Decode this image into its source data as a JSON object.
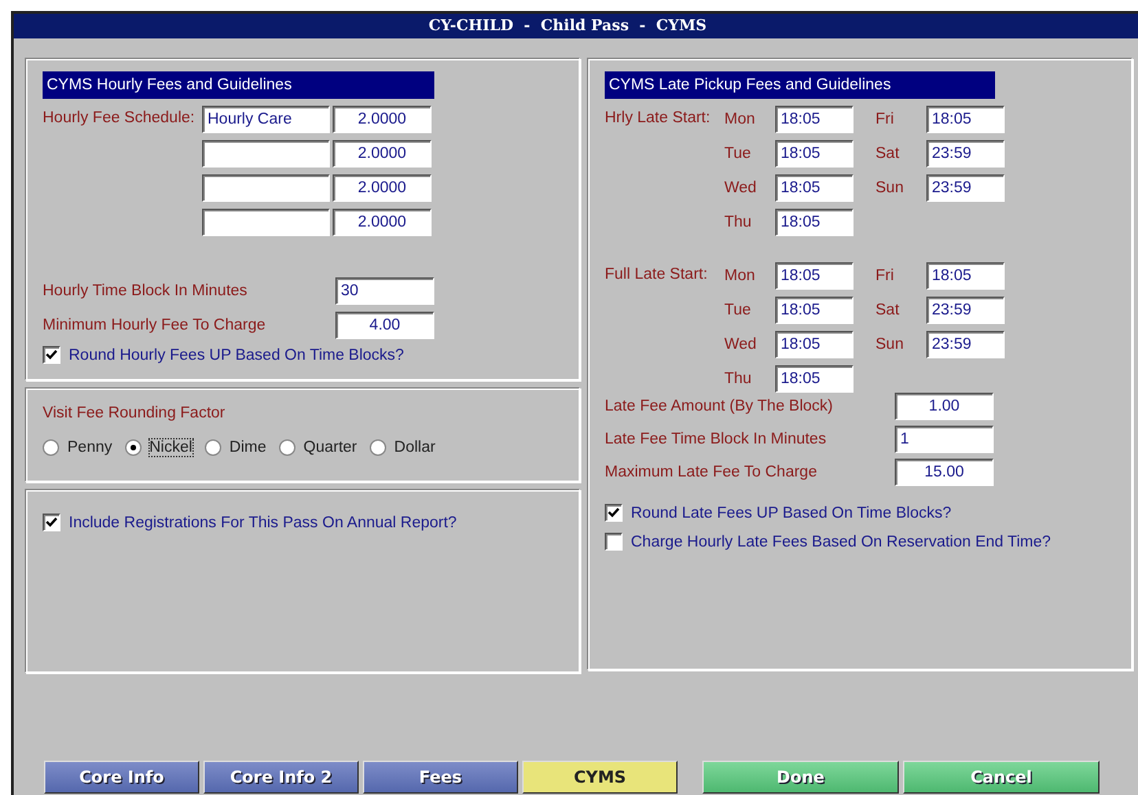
{
  "window": {
    "title": "CY-CHILD  -  Child Pass  -  CYMS"
  },
  "hourly": {
    "header": "CYMS Hourly Fees and Guidelines",
    "schedule_label": "Hourly Fee Schedule:",
    "schedule": [
      {
        "name": "Hourly Care",
        "amount": "2.0000"
      },
      {
        "amount": "2.0000"
      },
      {
        "amount": "2.0000"
      },
      {
        "amount": "2.0000"
      }
    ],
    "fields": [
      {
        "label": "Hourly Time Block In Minutes",
        "value": "30",
        "kind": "minutes"
      },
      {
        "label": "Minimum Hourly Fee To Charge",
        "value": "4.00",
        "kind": "amount"
      }
    ],
    "round": {
      "label": "Round Hourly Fees UP Based On Time Blocks?",
      "checked": true
    }
  },
  "rounding": {
    "label": "Visit Fee Rounding Factor",
    "options": [
      {
        "label": "Penny",
        "selected": false
      },
      {
        "label": "Nickel",
        "selected": true
      },
      {
        "label": "Dime",
        "selected": false
      },
      {
        "label": "Quarter",
        "selected": false
      },
      {
        "label": "Dollar",
        "selected": false
      }
    ]
  },
  "annual": {
    "label": "Include Registrations For This Pass On Annual Report?",
    "checked": true
  },
  "late": {
    "header": "CYMS Late Pickup Fees and Guidelines",
    "groups": [
      {
        "label": "Hrly Late Start:",
        "days": [
          {
            "day": "Mon",
            "time": "18:05"
          },
          {
            "day": "Tue",
            "time": "18:05"
          },
          {
            "day": "Wed",
            "time": "18:05"
          },
          {
            "day": "Thu",
            "time": "18:05"
          },
          {
            "day": "Fri",
            "time": "18:05"
          },
          {
            "day": "Sat",
            "time": "23:59"
          },
          {
            "day": "Sun",
            "time": "23:59"
          }
        ]
      },
      {
        "label": "Full Late Start:",
        "days": [
          {
            "day": "Mon",
            "time": "18:05"
          },
          {
            "day": "Tue",
            "time": "18:05"
          },
          {
            "day": "Wed",
            "time": "18:05"
          },
          {
            "day": "Thu",
            "time": "18:05"
          },
          {
            "day": "Fri",
            "time": "18:05"
          },
          {
            "day": "Sat",
            "time": "23:59"
          },
          {
            "day": "Sun",
            "time": "23:59"
          }
        ]
      }
    ],
    "fields": [
      {
        "label": "Late Fee Amount (By The Block)",
        "value": "1.00",
        "kind": "amount"
      },
      {
        "label": "Late Fee Time Block In Minutes",
        "value": "1",
        "kind": "minutes"
      },
      {
        "label": "Maximum Late Fee To Charge",
        "value": "15.00",
        "kind": "amount"
      }
    ],
    "checks": [
      {
        "label": "Round Late Fees UP Based On Time Blocks?",
        "checked": true
      },
      {
        "label": "Charge Hourly Late Fees Based On Reservation End Time?",
        "checked": false
      }
    ]
  },
  "tabs": [
    {
      "label": "Core Info",
      "selected": false
    },
    {
      "label": "Core Info 2",
      "selected": false
    },
    {
      "label": "Fees",
      "selected": false
    },
    {
      "label": "CYMS",
      "selected": true
    }
  ],
  "buttons": [
    "Done",
    "Cancel"
  ]
}
